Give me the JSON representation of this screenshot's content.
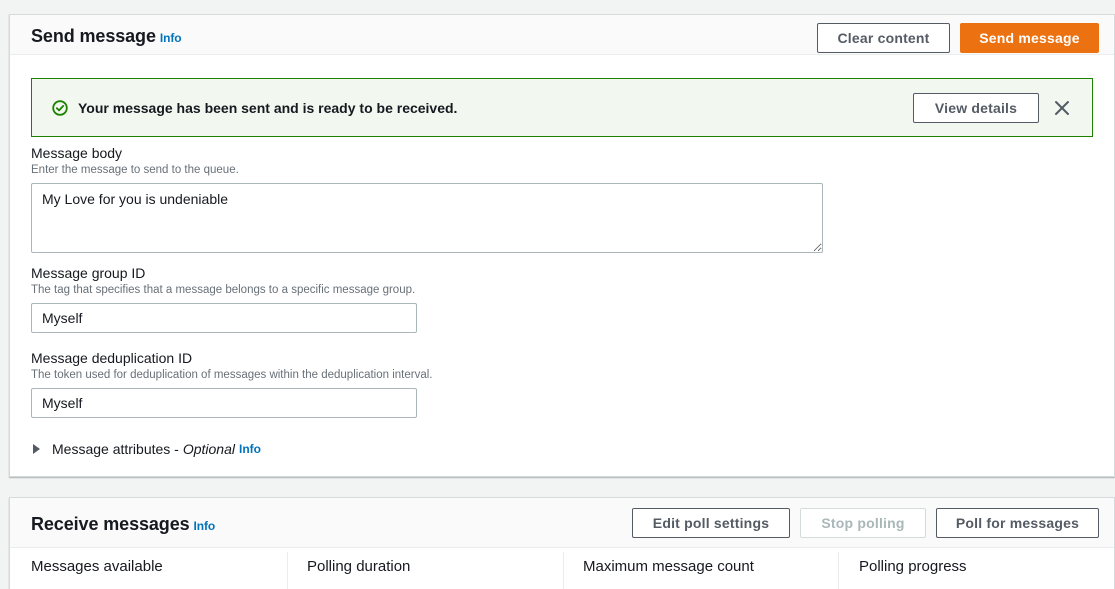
{
  "send_panel": {
    "title": "Send message",
    "info": "Info",
    "clear_button": "Clear content",
    "send_button": "Send message"
  },
  "flash": {
    "message": "Your message has been sent and is ready to be received.",
    "view_details": "View details",
    "status_color": "#1d8102"
  },
  "fields": {
    "body": {
      "label": "Message body",
      "description": "Enter the message to send to the queue.",
      "value": "My Love for you is undeniable"
    },
    "group_id": {
      "label": "Message group ID",
      "description": "The tag that specifies that a message belongs to a specific message group.",
      "value": "Myself"
    },
    "dedup_id": {
      "label": "Message deduplication ID",
      "description": "The token used for deduplication of messages within the deduplication interval.",
      "value": "Myself"
    }
  },
  "attributes": {
    "label": "Message attributes -",
    "optional": "Optional",
    "info": "Info"
  },
  "receive_panel": {
    "title": "Receive messages",
    "info": "Info",
    "edit_poll_button": "Edit poll settings",
    "stop_polling_button": "Stop polling",
    "poll_button": "Poll for messages",
    "stats": [
      "Messages available",
      "Polling duration",
      "Maximum message count",
      "Polling progress"
    ]
  },
  "colors": {
    "primary": "#ec7211",
    "link": "#0073bb",
    "success": "#1d8102"
  }
}
